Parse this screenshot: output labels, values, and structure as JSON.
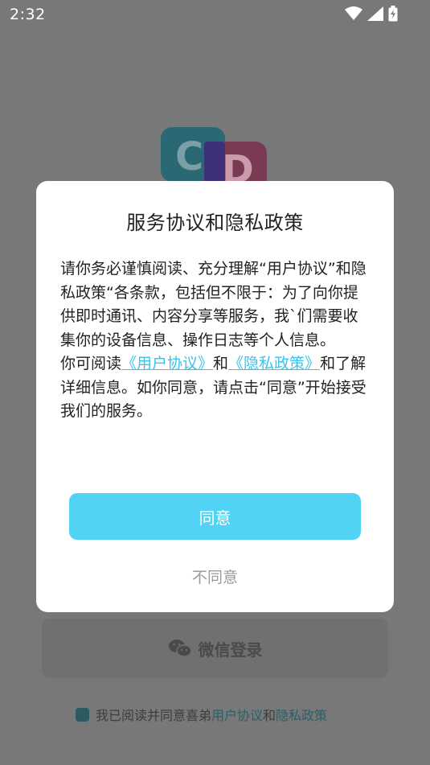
{
  "status_bar": {
    "time": "2:32"
  },
  "logo": {
    "letter_1": "C",
    "letter_2": "D"
  },
  "background": {
    "wechat_login_label": "微信登录",
    "agreement_prefix": "我已阅读并同意喜弟",
    "agreement_link_1": "用户协议",
    "agreement_and": "和",
    "agreement_link_2": "隐私政策"
  },
  "dialog": {
    "title": "服务协议和隐私政策",
    "paragraph_1": "请你务必谨慎阅读、充分理解“用户协议”和隐私政策“各条款，包括但不限于：为了向你提供即时通讯、内容分享等服务，我`们需要收集你的设备信息、操作日志等个人信息。",
    "p2_prefix": "你可阅读",
    "p2_link_1": "《用户协议》",
    "p2_and": "和",
    "p2_link_2": "《隐私政策》",
    "p2_suffix": "和了解详细信息。如你同意，请点击“同意”开始接受我们的服务。",
    "agree_label": "同意",
    "disagree_label": "不同意"
  },
  "colors": {
    "accent": "#52d3f5",
    "link": "#38c4ec",
    "dialog_bg": "#ffffff",
    "scrim": "#787878"
  }
}
